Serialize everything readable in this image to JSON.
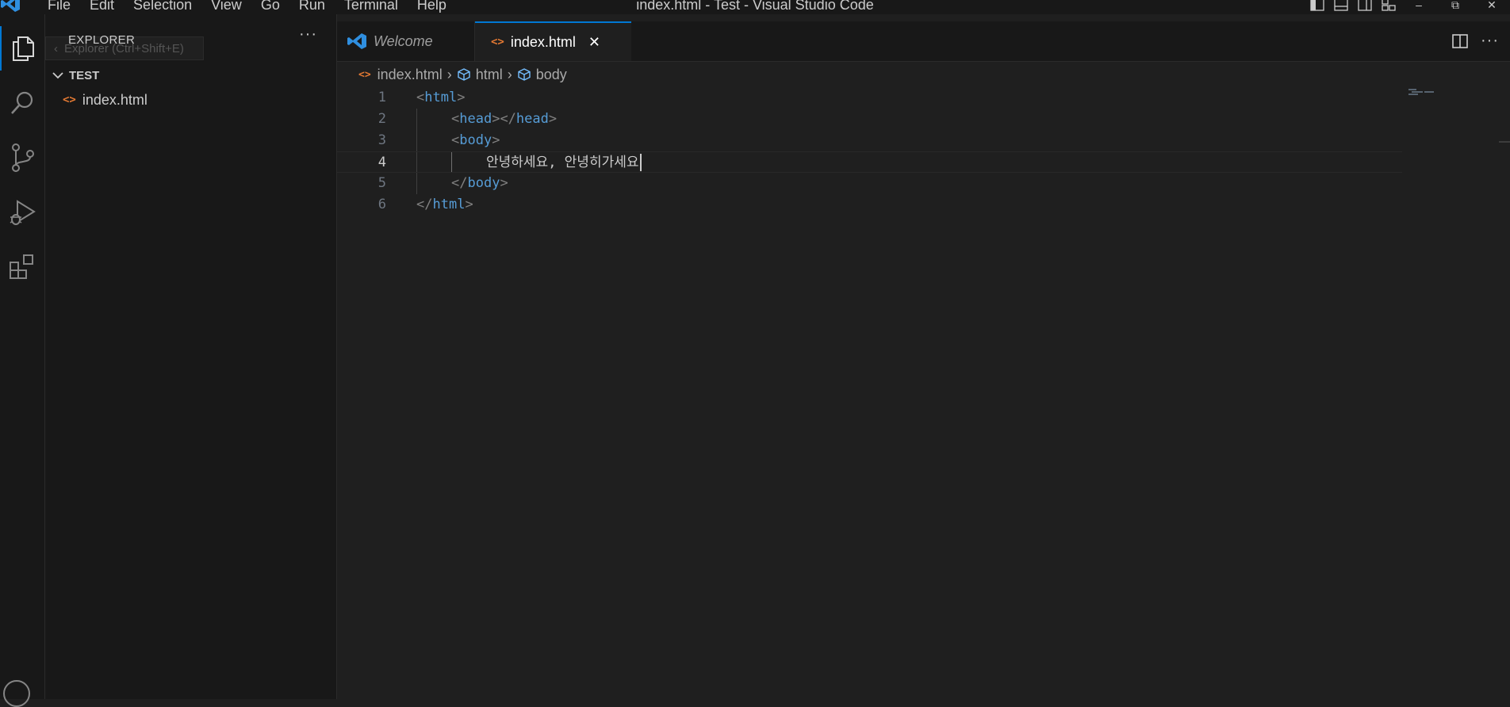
{
  "titlebar": {
    "menu": [
      "File",
      "Edit",
      "Selection",
      "View",
      "Go",
      "Run",
      "Terminal",
      "Help"
    ],
    "title": "index.html - Test - Visual Studio Code",
    "window_controls": {
      "minimize": "–",
      "restore": "⧉",
      "close": "✕"
    }
  },
  "activity": [
    "explorer-icon",
    "search-icon",
    "source-control-icon",
    "run-debug-icon",
    "extensions-icon"
  ],
  "sidebar": {
    "title": "EXPLORER",
    "tooltip": "Explorer (Ctrl+Shift+E)",
    "more": "···",
    "folder": "TEST",
    "file": "index.html"
  },
  "tabs": [
    {
      "label": "Welcome"
    },
    {
      "label": "index.html",
      "active": true
    }
  ],
  "breadcrumb": [
    "index.html",
    "html",
    "body"
  ],
  "code": {
    "line_numbers": [
      "1",
      "2",
      "3",
      "4",
      "5",
      "6"
    ],
    "current_line": "4",
    "lines": {
      "l1": {
        "open": "<",
        "tag": "html",
        "close": ">"
      },
      "l2": {
        "open1": "<",
        "tag1": "head",
        "close1": "></",
        "tag2": "head",
        "close2": ">"
      },
      "l3": {
        "open": "<",
        "tag": "body",
        "close": ">"
      },
      "l4": {
        "text": "안녕하세요, 안녕히가세요"
      },
      "l5": {
        "open": "</",
        "tag": "body",
        "close": ">"
      },
      "l6": {
        "open": "</",
        "tag": "html",
        "close": ">"
      }
    }
  },
  "colors": {
    "accent": "#0078d4",
    "tag_name": "#569cd6",
    "tag_bracket": "#808080",
    "html_file_icon": "#e37933"
  }
}
